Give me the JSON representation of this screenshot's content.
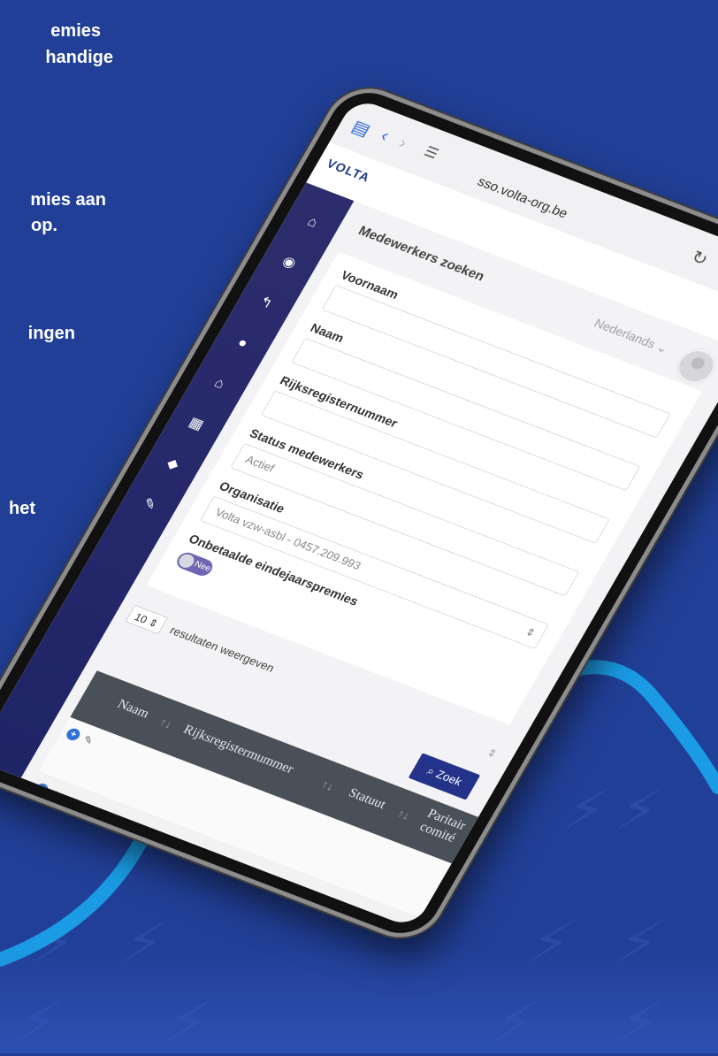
{
  "marketing": {
    "lines": [
      "emies",
      "handige",
      "mies aan",
      "op.",
      "ingen",
      "het"
    ]
  },
  "browser": {
    "url": "sso.volta-org.be",
    "back_icon": "chevron-left-icon",
    "forward_icon": "chevron-right-icon",
    "reload_icon": "reload-icon",
    "share_icon": "share-icon",
    "new_tab_icon": "plus-icon",
    "tabs_icon": "tabs-icon"
  },
  "app": {
    "brand": "VOLTA",
    "language": "Nederlands",
    "page_title": "Medewerkers zoeken"
  },
  "form": {
    "voornaam_label": "Voornaam",
    "naam_label": "Naam",
    "rijks_label": "Rijksregisternummer",
    "status_label": "Status medewerkers",
    "status_value": "Actief",
    "org_label": "Organisatie",
    "org_value": "Volta vzw-asbl - 0457.209.993",
    "premie_label": "Onbetaalde eindejaarspremies",
    "toggle_label": "Nee"
  },
  "results": {
    "length_value": "10",
    "length_label": "resultaten weergeven",
    "search_button": "Zoek"
  },
  "table": {
    "headers": [
      "Naam",
      "Rijksregistermummer",
      "Statuut",
      "Paritair comité"
    ]
  },
  "colors": {
    "background": "#213f96",
    "sidebar": "#2c2d6d",
    "primary": "#23338a",
    "accent_curve": "#1a9be3"
  }
}
